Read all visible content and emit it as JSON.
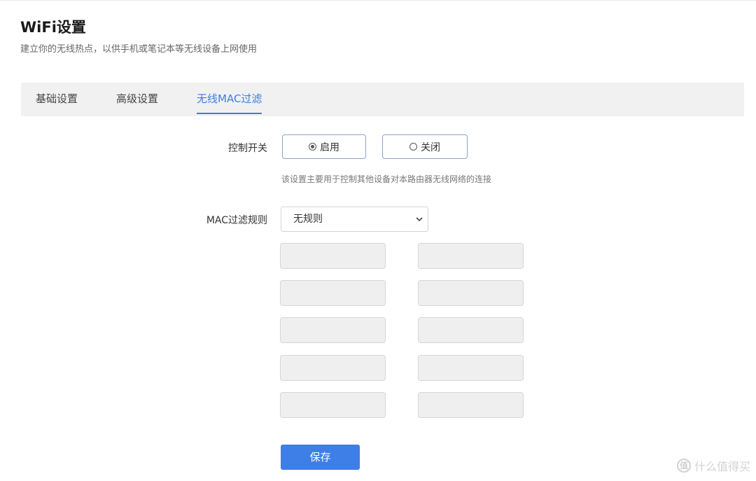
{
  "header": {
    "title": "WiFi设置",
    "subtitle": "建立你的无线热点，以供手机或笔记本等无线设备上网使用"
  },
  "tabs": [
    {
      "label": "基础设置",
      "active": false
    },
    {
      "label": "高级设置",
      "active": false
    },
    {
      "label": "无线MAC过滤",
      "active": true
    }
  ],
  "control_switch": {
    "label": "控制开关",
    "options": [
      {
        "label": "启用",
        "checked": true
      },
      {
        "label": "关闭",
        "checked": false
      }
    ],
    "hint": "该设置主要用于控制其他设备对本路由器无线网络的连接"
  },
  "mac_filter": {
    "label": "MAC过滤规则",
    "selected": "无规则",
    "entries": [
      "",
      "",
      "",
      "",
      "",
      "",
      "",
      "",
      "",
      ""
    ]
  },
  "actions": {
    "save_label": "保存"
  },
  "watermark": {
    "icon_text": "值",
    "text": "什么值得买"
  },
  "colors": {
    "accent": "#3e7ee7",
    "tab_bar_bg": "#f1f1f1",
    "input_disabled_bg": "#efefef"
  }
}
